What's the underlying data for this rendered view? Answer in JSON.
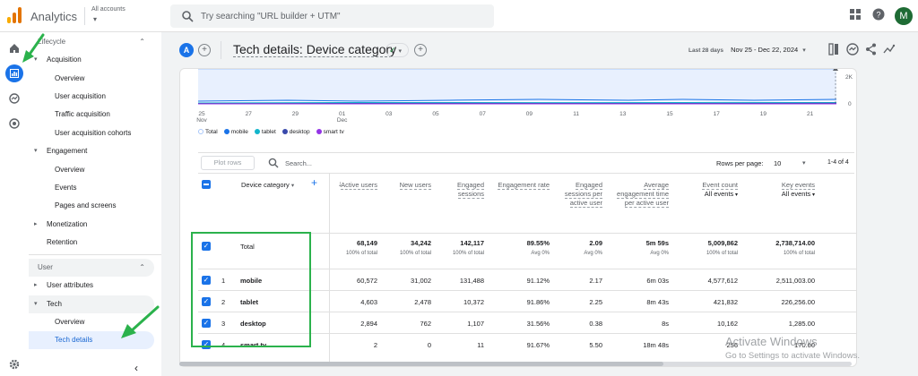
{
  "app": {
    "title": "Analytics",
    "account": "All accounts",
    "search_placeholder": "Try searching \"URL builder + UTM\"",
    "user_initial": "M"
  },
  "sidebar": {
    "lifecycle_label": "Lifecycle",
    "items": [
      {
        "label": "Acquisition"
      },
      {
        "label": "Overview"
      },
      {
        "label": "User acquisition"
      },
      {
        "label": "Traffic acquisition"
      },
      {
        "label": "User acquisition cohorts"
      },
      {
        "label": "Engagement"
      },
      {
        "label": "Overview"
      },
      {
        "label": "Events"
      },
      {
        "label": "Pages and screens"
      },
      {
        "label": "Monetization"
      },
      {
        "label": "Retention"
      },
      {
        "label": "User"
      },
      {
        "label": "User attributes"
      },
      {
        "label": "Tech"
      },
      {
        "label": "Overview"
      },
      {
        "label": "Tech details"
      }
    ]
  },
  "report": {
    "comparison_badge": "A",
    "title": "Tech details: Device category",
    "date_label": "Last 28 days",
    "date_range": "Nov 25 - Dec 22, 2024"
  },
  "chart_data": {
    "type": "line",
    "x": [
      "25 Nov",
      "27",
      "29",
      "01 Dec",
      "03",
      "05",
      "07",
      "09",
      "11",
      "13",
      "15",
      "17",
      "19",
      "21"
    ],
    "y_ticks": [
      "2K",
      "0"
    ],
    "series": [
      {
        "name": "Total",
        "color": "#a8c7fa"
      },
      {
        "name": "mobile",
        "color": "#1a73e8"
      },
      {
        "name": "tablet",
        "color": "#12b5cb"
      },
      {
        "name": "desktop",
        "color": "#3949ab"
      },
      {
        "name": "smart tv",
        "color": "#9334e6"
      }
    ]
  },
  "table_toolbar": {
    "plot_rows": "Plot rows",
    "search_label": "Search...",
    "rows_per_page_label": "Rows per page:",
    "rows_per_page": "10",
    "pager": "1-4 of 4"
  },
  "table": {
    "dimension_header": "Device category",
    "columns": [
      {
        "label": "Active users",
        "sub": ""
      },
      {
        "label": "New users",
        "sub": ""
      },
      {
        "label": "Engaged sessions",
        "sub": ""
      },
      {
        "label": "Engagement rate",
        "sub": ""
      },
      {
        "label": "Engaged sessions per active user",
        "sub": ""
      },
      {
        "label": "Average engagement time per active user",
        "sub": ""
      },
      {
        "label": "Event count",
        "sub": "All events"
      },
      {
        "label": "Key events",
        "sub": "All events"
      }
    ],
    "total": {
      "label": "Total",
      "values": [
        "68,149",
        "34,242",
        "142,117",
        "89.55%",
        "2.09",
        "5m 59s",
        "5,009,862",
        "2,738,714.00"
      ],
      "subs": [
        "100% of total",
        "100% of total",
        "100% of total",
        "Avg 0%",
        "Avg 0%",
        "Avg 0%",
        "100% of total",
        "100% of total"
      ]
    },
    "rows": [
      {
        "index": "1",
        "name": "mobile",
        "values": [
          "60,572",
          "31,002",
          "131,488",
          "91.12%",
          "2.17",
          "6m 03s",
          "4,577,612",
          "2,511,003.00"
        ]
      },
      {
        "index": "2",
        "name": "tablet",
        "values": [
          "4,603",
          "2,478",
          "10,372",
          "91.86%",
          "2.25",
          "8m 43s",
          "421,832",
          "226,256.00"
        ]
      },
      {
        "index": "3",
        "name": "desktop",
        "values": [
          "2,894",
          "762",
          "1,107",
          "31.56%",
          "0.38",
          "8s",
          "10,162",
          "1,285.00"
        ]
      },
      {
        "index": "4",
        "name": "smart tv",
        "values": [
          "2",
          "0",
          "11",
          "91.67%",
          "5.50",
          "18m 48s",
          "256",
          "170.00"
        ]
      }
    ]
  },
  "watermark": {
    "line1": "Activate Windows",
    "line2": "Go to Settings to activate Windows."
  }
}
